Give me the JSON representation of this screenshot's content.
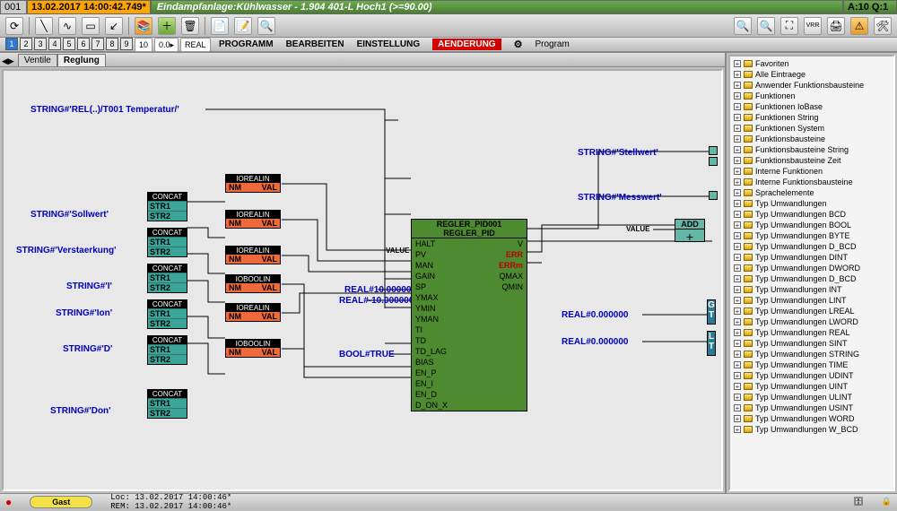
{
  "header": {
    "id": "001",
    "time": "13.02.2017 14:00:42.749*",
    "title": "Eindampfanlage:Kühlwasser - 1.904 401-L Hoch1 (>=90.00)",
    "aq": "A:10 Q:1"
  },
  "toolbar": {
    "nums": [
      "1",
      "2",
      "3",
      "4",
      "5",
      "6",
      "7",
      "8",
      "9",
      "10"
    ],
    "pill10": "10",
    "pill00": "0.0▸",
    "pillR": "REAL"
  },
  "menu": {
    "prog": "PROGRAMM",
    "edit": "BEARBEITEN",
    "set": "EINSTELLUNG",
    "chg": "AENDERUNG",
    "program": "Program"
  },
  "tabs": {
    "ventile": "Ventile",
    "reglung": "Reglung"
  },
  "labels": {
    "temp": "STRING#'REL(..)/T001 Temperatur/'",
    "soll": "STRING#'Sollwert'",
    "verst": "STRING#'Verstaerkung'",
    "I": "STRING#'I'",
    "Ion": "STRING#'Ion'",
    "D": "STRING#'D'",
    "Don": "STRING#'Don'",
    "stell": "STRING#'Stellwert'",
    "mess": "STRING#'Messwert'",
    "real10p": "REAL#10.000000",
    "real10n": "REAL#-10.000000",
    "booltrue": "BOOL#TRUE",
    "real0a": "REAL#0.000000",
    "real0b": "REAL#0.000000",
    "value": "VALUE",
    "value2": "VALUE"
  },
  "blocks": {
    "concat": {
      "t": "CONCAT",
      "r1": "STR1",
      "r2": "STR2"
    },
    "io": {
      "t": "IOREALIN",
      "l": "NM",
      "r": "VAL"
    },
    "iob": {
      "t": "IOBOOLIN",
      "l": "NM",
      "r": "VAL"
    },
    "pid": {
      "name": "REGLER_PID001",
      "type": "REGLER_PID",
      "rows": [
        [
          "HALT",
          "V"
        ],
        [
          "PV",
          "ERR"
        ],
        [
          "MAN",
          "ERRm"
        ],
        [
          "GAIN",
          "QMAX"
        ],
        [
          "SP",
          "QMIN"
        ],
        [
          "YMAX",
          ""
        ],
        [
          "YMIN",
          ""
        ],
        [
          "YMAN",
          ""
        ],
        [
          "TI",
          ""
        ],
        [
          "TD",
          ""
        ],
        [
          "TD_LAG",
          ""
        ],
        [
          "BIAS",
          ""
        ],
        [
          "EN_P",
          ""
        ],
        [
          "EN_I",
          ""
        ],
        [
          "EN_D",
          ""
        ],
        [
          "D_ON_X",
          ""
        ]
      ]
    },
    "add": {
      "t": "ADD",
      "sym": "+"
    }
  },
  "tree": [
    "Favoriten",
    "Alle Eintraege",
    "Anwender Funktionsbausteine",
    "Funktionen",
    "Funktionen IoBase",
    "Funktionen String",
    "Funktionen System",
    "Funktionsbausteine",
    "Funktionsbausteine String",
    "Funktionsbausteine Zeit",
    "Interne Funktionen",
    "Interne Funktionsbausteine",
    "Sprachelemente",
    "Typ Umwandlungen",
    "Typ Umwandlungen BCD",
    "Typ Umwandlungen BOOL",
    "Typ Umwandlungen BYTE",
    "Typ Umwandlungen D_BCD",
    "Typ Umwandlungen DINT",
    "Typ Umwandlungen DWORD",
    "Typ Umwandlungen D_BCD",
    "Typ Umwandlungen INT",
    "Typ Umwandlungen LINT",
    "Typ Umwandlungen LREAL",
    "Typ Umwandlungen LWORD",
    "Typ Umwandlungen REAL",
    "Typ Umwandlungen SINT",
    "Typ Umwandlungen STRING",
    "Typ Umwandlungen TIME",
    "Typ Umwandlungen UDINT",
    "Typ Umwandlungen UINT",
    "Typ Umwandlungen ULINT",
    "Typ Umwandlungen USINT",
    "Typ Umwandlungen WORD",
    "Typ Umwandlungen W_BCD"
  ],
  "status": {
    "user": "Gast",
    "times": "Loc: 13.02.2017 14:00:46*\nREM: 13.02.2017 14:00:46*"
  }
}
